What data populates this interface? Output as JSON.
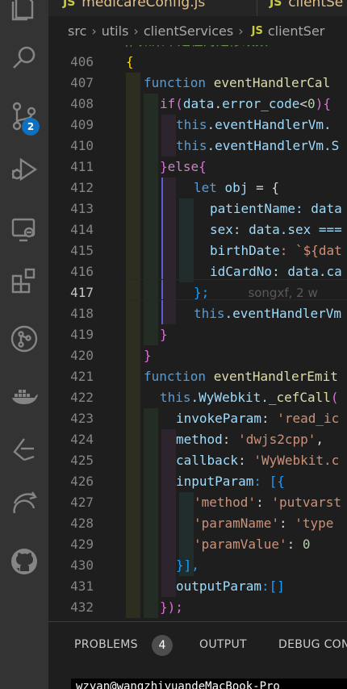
{
  "tabs": [
    {
      "label": "medicareConfig.js",
      "icon": "JS"
    },
    {
      "label": "clientSe",
      "icon": "JS"
    }
  ],
  "breadcrumb": {
    "parts": [
      "src",
      "utils",
      "clientServices"
    ],
    "file_icon": "JS",
    "file": "clientSer"
  },
  "activity_bar": {
    "items": [
      "explorer-icon",
      "search-icon",
      "source-control-icon",
      "run-debug-icon",
      "remote-explorer-icon",
      "extensions-icon",
      "git-graph-icon",
      "docker-icon",
      "live-share-icon",
      "remote-icon",
      "github-icon"
    ],
    "source_control_badge": "2"
  },
  "editor": {
    "current_line": "417",
    "top_comment": "// 如果不是在对是修改数",
    "line_numbers": [
      "406",
      "407",
      "408",
      "409",
      "410",
      "411",
      "412",
      "413",
      "414",
      "415",
      "416",
      "417",
      "418",
      "419",
      "420",
      "421",
      "422",
      "423",
      "424",
      "425",
      "426",
      "427",
      "428",
      "429",
      "430",
      "431",
      "432"
    ],
    "blame": "songxf, 2 w",
    "tokens": {
      "l406": "{",
      "l407_kw": "function",
      "l407_fn": "eventHandlerCal",
      "l408_ctrl": "if",
      "l408_a": "(",
      "l408_b": "data",
      "l408_c": ".",
      "l408_d": "error_code",
      "l408_e": "<",
      "l408_f": "0",
      "l408_g": "){",
      "l409_kw": "this",
      "l409_rest": ".eventHandlerVm.",
      "l410_kw": "this",
      "l410_rest": ".eventHandlerVm.S",
      "l411_a": "}",
      "l411_b": "else",
      "l411_c": "{",
      "l412_kw": "let",
      "l412_var": "obj",
      "l412_rest": " = {",
      "l413_var": "patientName",
      "l413_rest": ": data",
      "l414_var": "sex",
      "l414_rest": ": data.sex ===",
      "l415_var": "birthDate",
      "l415_rest": ": `${dat",
      "l416_var": "idCardNo",
      "l416_rest": ": data.ca",
      "l417": "};",
      "l418_kw": "this",
      "l418_rest": ".eventHandlerVm",
      "l419": "}",
      "l420": "}",
      "l421_kw": "function",
      "l421_fn": "eventHandlerEmit",
      "l422_kw": "this",
      "l422_rest": ".WyWebkit.",
      "l422_fn": "_cefCall",
      "l422_p": "(",
      "l423_var": "invokeParam",
      "l423_str": "'read_ic",
      "l424_var": "method",
      "l424_str": "'dwjs2cpp'",
      "l425_var": "callback",
      "l425_str": "'WyWebkit.c",
      "l426_var": "inputParam",
      "l426_rest": ": [{",
      "l427_str": "'method'",
      "l427_str2": "'putvarst",
      "l428_str": "'paramName'",
      "l428_str2": "'type",
      "l429_str": "'paramValue'",
      "l429_num": "0",
      "l430": "}],",
      "l431_var": "outputParam",
      "l431_rest": ":[]",
      "l432": "});"
    }
  },
  "panel": {
    "tabs": [
      "PROBLEMS",
      "OUTPUT",
      "DEBUG CON"
    ],
    "problems_count": "4",
    "terminal_text": "wzyan@wangzhiyuandeMacBook-Pro"
  },
  "colors": {
    "activity_bar": "#333333",
    "editor_bg": "#1e1e1e",
    "badge": "#0e70c0",
    "keyword": "#569cd6",
    "function": "#dcdcaa",
    "string": "#ce9178"
  }
}
